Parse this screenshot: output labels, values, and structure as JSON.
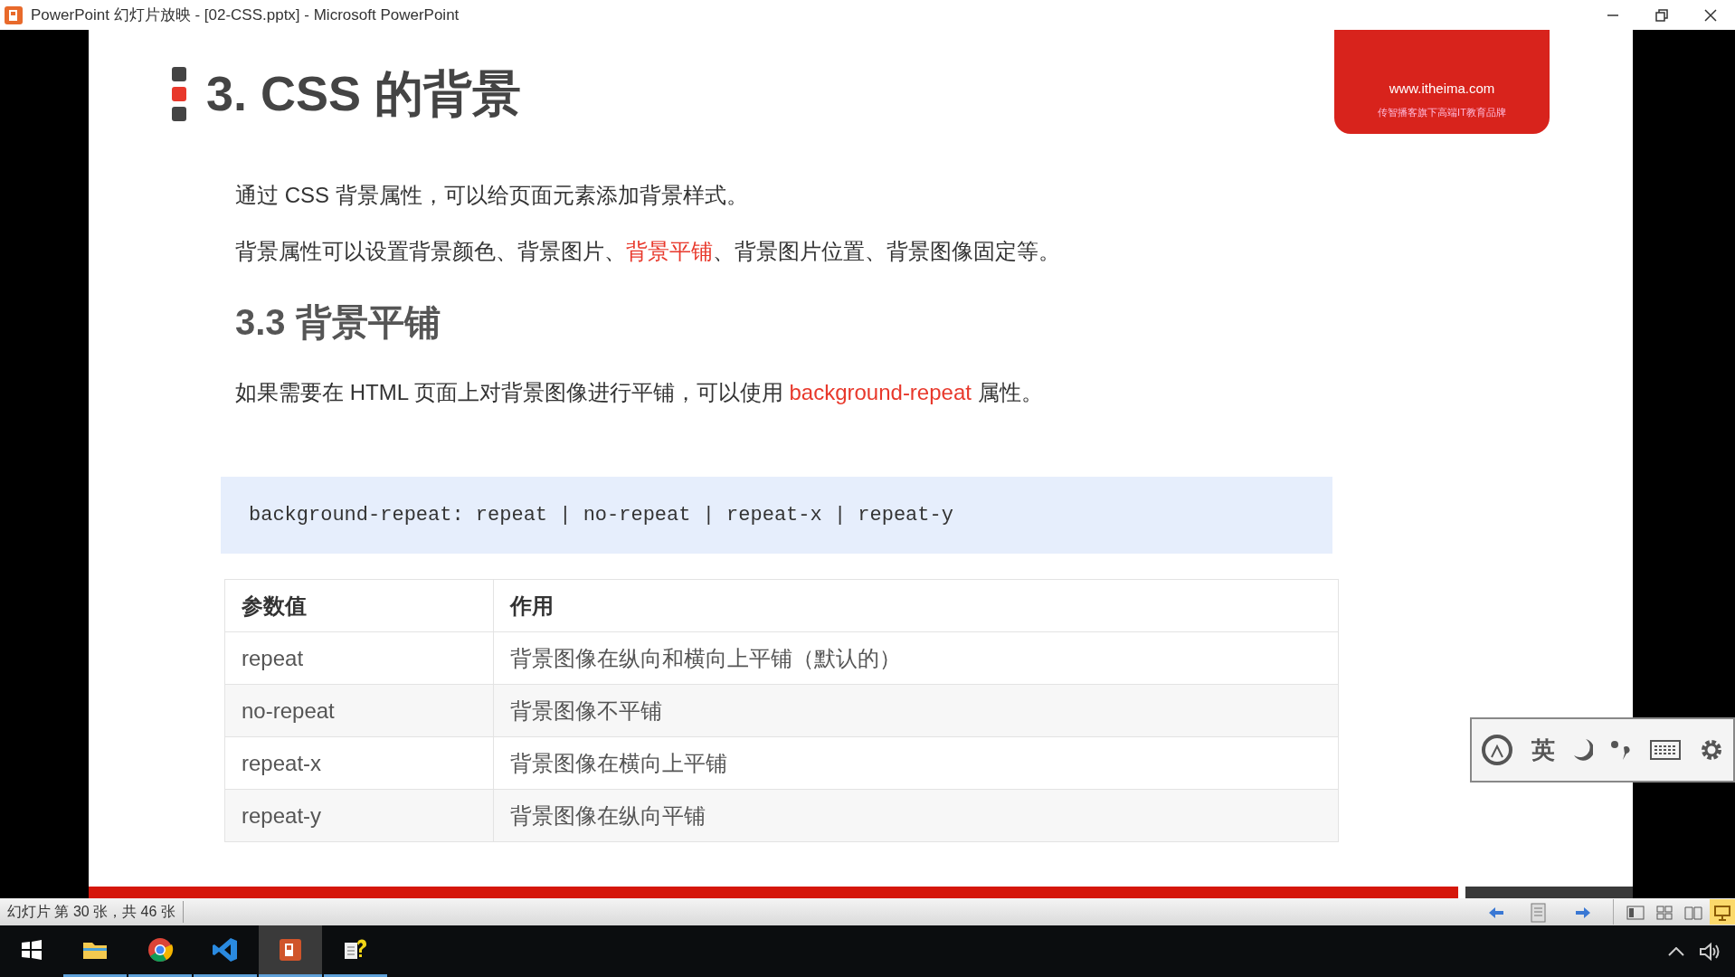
{
  "window": {
    "title": "PowerPoint 幻灯片放映 - [02-CSS.pptx] - Microsoft PowerPoint"
  },
  "slide": {
    "title": "3. CSS 的背景",
    "logo": {
      "url": "www.itheima.com",
      "tagline": "传智播客旗下高端IT教育品牌"
    },
    "paragraphs": [
      [
        {
          "text": "通过 CSS 背景属性，可以给页面元素添加背景样式。",
          "highlight": false
        }
      ],
      [
        {
          "text": "背景属性可以设置背景颜色、背景图片、",
          "highlight": false
        },
        {
          "text": "背景平铺",
          "highlight": true
        },
        {
          "text": "、背景图片位置、背景图像固定等。",
          "highlight": false
        }
      ]
    ],
    "subheading": "3.3 背景平铺",
    "description": [
      {
        "text": "如果需要在 HTML 页面上对背景图像进行平铺，可以使用 ",
        "highlight": false
      },
      {
        "text": "background-repeat",
        "highlight": true
      },
      {
        "text": " 属性。",
        "highlight": false
      }
    ],
    "code": "background-repeat: repeat | no-repeat | repeat-x | repeat-y",
    "table": {
      "columns": [
        "参数值",
        "作用"
      ],
      "rows": [
        [
          "repeat",
          "背景图像在纵向和横向上平铺（默认的）"
        ],
        [
          "no-repeat",
          "背景图像不平铺"
        ],
        [
          "repeat-x",
          "背景图像在横向上平铺"
        ],
        [
          "repeat-y",
          "背景图像在纵向平铺"
        ]
      ]
    }
  },
  "ime_toolbar": {
    "language": "英"
  },
  "status_bar": {
    "slide_info": "幻灯片 第 30 张，共 46 张",
    "views": [
      {
        "kind": "normal",
        "selected": false
      },
      {
        "kind": "sorter",
        "selected": false
      },
      {
        "kind": "reading",
        "selected": false
      },
      {
        "kind": "slideshow",
        "selected": true
      }
    ]
  },
  "taskbar": {
    "apps": [
      {
        "kind": "explorer",
        "selected": false
      },
      {
        "kind": "chrome",
        "selected": false
      },
      {
        "kind": "vscode",
        "selected": false
      },
      {
        "kind": "powerpoint",
        "selected": true
      },
      {
        "kind": "help",
        "selected": false
      }
    ]
  }
}
